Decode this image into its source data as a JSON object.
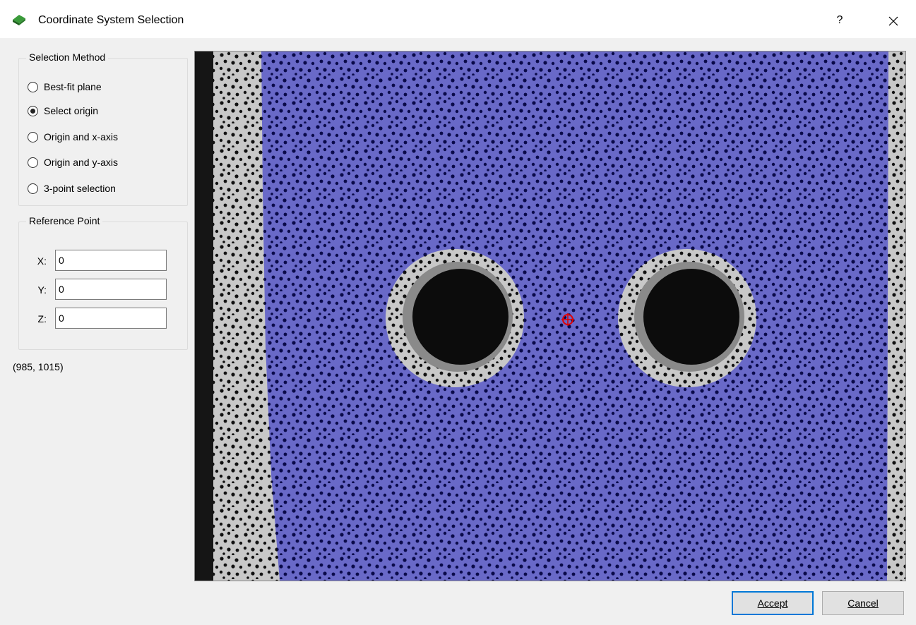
{
  "window": {
    "title": "Coordinate System Selection",
    "help_label": "?",
    "close_label": "✕"
  },
  "selection_method": {
    "legend": "Selection Method",
    "options": [
      {
        "label": "Best-fit plane",
        "checked": false
      },
      {
        "label": "Select origin",
        "checked": true
      },
      {
        "label": "Origin and x-axis",
        "checked": false
      },
      {
        "label": "Origin and y-axis",
        "checked": false
      },
      {
        "label": "3-point selection",
        "checked": false
      }
    ]
  },
  "reference_point": {
    "legend": "Reference Point",
    "x_label": "X:",
    "x_value": "0",
    "y_label": "Y:",
    "y_value": "0",
    "z_label": "Z:",
    "z_value": "0"
  },
  "pixel_readout": "(985, 1015)",
  "buttons": {
    "accept": "Accept",
    "cancel": "Cancel"
  },
  "colors": {
    "overlay": "#5454c8",
    "marker": "#e00000"
  }
}
